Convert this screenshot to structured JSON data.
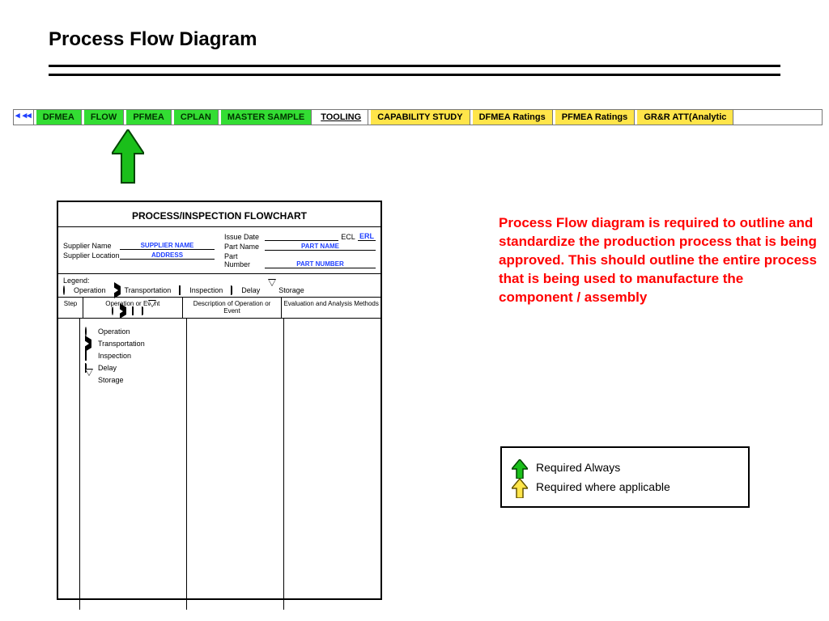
{
  "title": "Process Flow Diagram",
  "tabs": {
    "dfmea": "DFMEA",
    "flow": "FLOW",
    "pfmea": "PFMEA",
    "cplan": "CPLAN",
    "master_sample": "MASTER SAMPLE",
    "tooling": "TOOLING",
    "capability": "CAPABILITY STUDY",
    "dfmea_ratings": "DFMEA Ratings",
    "pfmea_ratings": "PFMEA Ratings",
    "grr": "GR&R ATT(Analytic"
  },
  "form": {
    "title": "PROCESS/INSPECTION FLOWCHART",
    "meta": {
      "supplier_name_label": "Supplier Name",
      "supplier_name_value": "SUPPLIER NAME",
      "supplier_loc_label": "Supplier Location",
      "supplier_loc_value": "ADDRESS",
      "issue_date_label": "Issue Date",
      "ecl_label": "ECL",
      "erl_label": "ERL",
      "part_name_label": "Part Name",
      "part_name_value": "PART NAME",
      "part_number_label": "Part Number",
      "part_number_value": "PART NUMBER"
    },
    "legend": {
      "title": "Legend:",
      "operation": "Operation",
      "transport": "Transportation",
      "inspection": "Inspection",
      "delay": "Delay",
      "storage": "Storage"
    },
    "columns": {
      "step": "Step",
      "op_event": "Operation or Event",
      "desc": "Description of Operation or Event",
      "eval": "Evaluation and Analysis Methods"
    },
    "body_items": {
      "operation": "Operation",
      "transport": "Transportation",
      "inspection": "Inspection",
      "delay": "Delay",
      "storage": "Storage"
    }
  },
  "description": "Process Flow diagram is required to outline and standardize the production process that is being approved. This should outline the entire process that is being used to manufacture the component / assembly",
  "key": {
    "always": "Required Always",
    "applicable": "Required where applicable"
  }
}
